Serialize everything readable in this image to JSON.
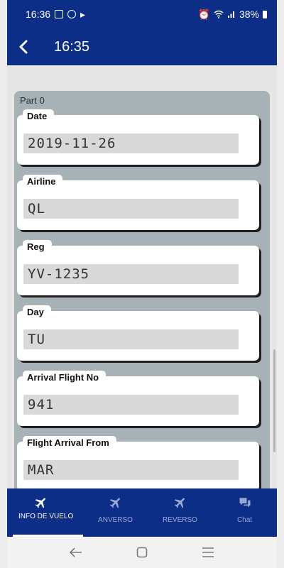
{
  "status_bar": {
    "time": "16:36",
    "battery": "38%"
  },
  "app_bar": {
    "title": "16:35"
  },
  "part": {
    "label": "Part 0"
  },
  "fields": [
    {
      "label": "Date",
      "value": "2019-11-26"
    },
    {
      "label": "Airline",
      "value": "QL"
    },
    {
      "label": "Reg",
      "value": "YV-1235"
    },
    {
      "label": "Day",
      "value": "TU"
    },
    {
      "label": "Arrival Flight No",
      "value": "941"
    },
    {
      "label": "Flight Arrival From",
      "value": "MAR"
    }
  ],
  "bottom_nav": {
    "items": [
      {
        "label": "INFO DE VUELO",
        "icon": "airplane-icon",
        "active": true
      },
      {
        "label": "ANVERSO",
        "icon": "airplane-icon",
        "active": false
      },
      {
        "label": "REVERSO",
        "icon": "airplane-icon",
        "active": false
      },
      {
        "label": "Chat",
        "icon": "chat-icon",
        "active": false
      }
    ]
  },
  "colors": {
    "primary": "#0d2e86",
    "panel": "#a6b2b6",
    "field_bg": "#d9d9d9"
  }
}
